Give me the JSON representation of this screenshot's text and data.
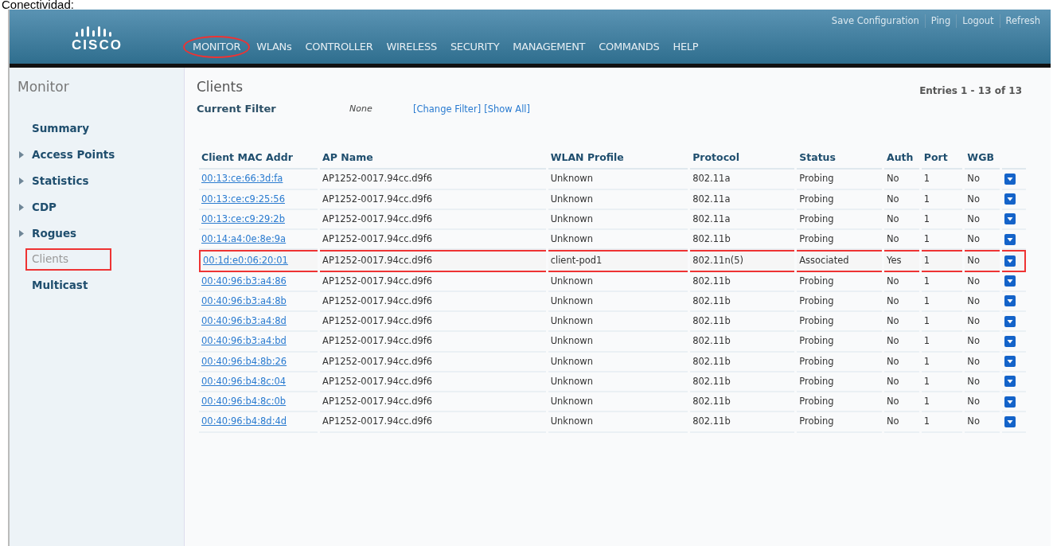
{
  "caption": "Conectividad:",
  "header": {
    "logo": "CISCO",
    "links": [
      "Save Configuration",
      "Ping",
      "Logout",
      "Refresh"
    ],
    "menu": [
      {
        "label": "MONITOR",
        "selected": true
      },
      {
        "label": "WLANs",
        "selected": false
      },
      {
        "label": "CONTROLLER",
        "selected": false
      },
      {
        "label": "WIRELESS",
        "selected": false
      },
      {
        "label": "SECURITY",
        "selected": false
      },
      {
        "label": "MANAGEMENT",
        "selected": false
      },
      {
        "label": "COMMANDS",
        "selected": false
      },
      {
        "label": "HELP",
        "selected": false
      }
    ]
  },
  "sidebar": {
    "title": "Monitor",
    "items": [
      {
        "label": "Summary",
        "expandable": false,
        "selected": false
      },
      {
        "label": "Access Points",
        "expandable": true,
        "selected": false
      },
      {
        "label": "Statistics",
        "expandable": true,
        "selected": false
      },
      {
        "label": "CDP",
        "expandable": true,
        "selected": false
      },
      {
        "label": "Rogues",
        "expandable": true,
        "selected": false
      },
      {
        "label": "Clients",
        "expandable": false,
        "selected": true
      },
      {
        "label": "Multicast",
        "expandable": false,
        "selected": false
      }
    ]
  },
  "content": {
    "title": "Clients",
    "entries": "Entries 1 - 13 of 13",
    "filter_label": "Current Filter",
    "filter_value": "None",
    "filter_links": [
      "[Change Filter]",
      "[Show All]"
    ],
    "table": {
      "columns": [
        "Client MAC Addr",
        "AP Name",
        "WLAN Profile",
        "Protocol",
        "Status",
        "Auth",
        "Port",
        "WGB"
      ],
      "rows": [
        {
          "cells": [
            "00:13:ce:66:3d:fa",
            "AP1252-0017.94cc.d9f6",
            "Unknown",
            "802.11a",
            "Probing",
            "No",
            "1",
            "No"
          ],
          "highlighted": false
        },
        {
          "cells": [
            "00:13:ce:c9:25:56",
            "AP1252-0017.94cc.d9f6",
            "Unknown",
            "802.11a",
            "Probing",
            "No",
            "1",
            "No"
          ],
          "highlighted": false
        },
        {
          "cells": [
            "00:13:ce:c9:29:2b",
            "AP1252-0017.94cc.d9f6",
            "Unknown",
            "802.11a",
            "Probing",
            "No",
            "1",
            "No"
          ],
          "highlighted": false
        },
        {
          "cells": [
            "00:14:a4:0e:8e:9a",
            "AP1252-0017.94cc.d9f6",
            "Unknown",
            "802.11b",
            "Probing",
            "No",
            "1",
            "No"
          ],
          "highlighted": false
        },
        {
          "cells": [
            "00:1d:e0:06:20:01",
            "AP1252-0017.94cc.d9f6",
            "client-pod1",
            "802.11n(5)",
            "Associated",
            "Yes",
            "1",
            "No"
          ],
          "highlighted": true
        },
        {
          "cells": [
            "00:40:96:b3:a4:86",
            "AP1252-0017.94cc.d9f6",
            "Unknown",
            "802.11b",
            "Probing",
            "No",
            "1",
            "No"
          ],
          "highlighted": false
        },
        {
          "cells": [
            "00:40:96:b3:a4:8b",
            "AP1252-0017.94cc.d9f6",
            "Unknown",
            "802.11b",
            "Probing",
            "No",
            "1",
            "No"
          ],
          "highlighted": false
        },
        {
          "cells": [
            "00:40:96:b3:a4:8d",
            "AP1252-0017.94cc.d9f6",
            "Unknown",
            "802.11b",
            "Probing",
            "No",
            "1",
            "No"
          ],
          "highlighted": false
        },
        {
          "cells": [
            "00:40:96:b3:a4:bd",
            "AP1252-0017.94cc.d9f6",
            "Unknown",
            "802.11b",
            "Probing",
            "No",
            "1",
            "No"
          ],
          "highlighted": false
        },
        {
          "cells": [
            "00:40:96:b4:8b:26",
            "AP1252-0017.94cc.d9f6",
            "Unknown",
            "802.11b",
            "Probing",
            "No",
            "1",
            "No"
          ],
          "highlighted": false
        },
        {
          "cells": [
            "00:40:96:b4:8c:04",
            "AP1252-0017.94cc.d9f6",
            "Unknown",
            "802.11b",
            "Probing",
            "No",
            "1",
            "No"
          ],
          "highlighted": false
        },
        {
          "cells": [
            "00:40:96:b4:8c:0b",
            "AP1252-0017.94cc.d9f6",
            "Unknown",
            "802.11b",
            "Probing",
            "No",
            "1",
            "No"
          ],
          "highlighted": false
        },
        {
          "cells": [
            "00:40:96:b4:8d:4d",
            "AP1252-0017.94cc.d9f6",
            "Unknown",
            "802.11b",
            "Probing",
            "No",
            "1",
            "No"
          ],
          "highlighted": false
        }
      ]
    }
  }
}
